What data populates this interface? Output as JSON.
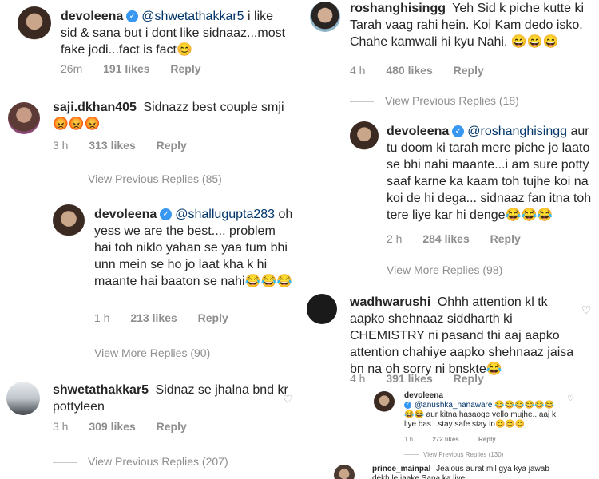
{
  "left": {
    "c1": {
      "user": "devoleena",
      "mention": "@shwetathakkar5",
      "text": "i like sid & sana but i dont like sidnaaz...most fake jodi...fact is fact😊",
      "time": "26m",
      "likes": "191 likes",
      "reply": "Reply"
    },
    "c2": {
      "user": "saji.dkhan405",
      "text": "Sidnazz best couple smji 😡😡😡",
      "time": "3 h",
      "likes": "313 likes",
      "reply": "Reply"
    },
    "vp1": "View Previous Replies (85)",
    "c3": {
      "user": "devoleena",
      "mention": "@shallugupta283",
      "text": "oh yess we are the best.... problem hai toh niklo yahan se yaa tum bhi unn mein se ho jo laat kha k hi maante hai baaton se nahi😂😂😂",
      "time": "1 h",
      "likes": "213 likes",
      "reply": "Reply"
    },
    "vm1": "View More Replies (90)",
    "c4": {
      "user": "shwetathakkar5",
      "text": "Sidnaz se jhalna bnd kr pottyleen",
      "time": "3 h",
      "likes": "309 likes",
      "reply": "Reply"
    },
    "vp2": "View Previous Replies (207)"
  },
  "right": {
    "c1": {
      "user": "roshanghisingg",
      "text": "Yeh Sid k piche kutte ki Tarah vaag rahi hein. Koi Kam dedo isko. Chahe kamwali hi kyu Nahi. 😄😄😄",
      "time": "4 h",
      "likes": "480 likes",
      "reply": "Reply"
    },
    "vp1": "View Previous Replies (18)",
    "c2": {
      "user": "devoleena",
      "mention": "@roshanghisingg",
      "text": "aur tu doom ki tarah mere piche jo laato se bhi nahi maante...i am sure potty saaf karne ka kaam toh tujhe koi na koi de hi dega... sidnaaz fan itna toh tere liye kar hi denge😂😂😂",
      "time": "2 h",
      "likes": "284 likes",
      "reply": "Reply"
    },
    "vm1": "View More Replies (98)",
    "c3": {
      "user": "wadhwarushi",
      "text": "Ohhh attention kl tk aapko shehnaaz siddharth ki CHEMISTRY ni pasand thi aaj aapko attention chahiye aapko shehnaaz jaisa bn na oh sorry ni bnskte😂",
      "time": "4 h",
      "likes": "391 likes",
      "reply": "Reply"
    },
    "c4": {
      "user": "devoleena",
      "mention": "@anushka_nanaware",
      "text": "😂😂😂😂😂😂😂😂 aur kitna hasaoge vello mujhe...aaj k liye bas...stay safe stay in😊😊😊",
      "time": "1 h",
      "likes": "272 likes",
      "reply": "Reply"
    },
    "vp2": "View Previous Replies (130)",
    "c5": {
      "user": "prince_mainpal",
      "text": "Jealous aurat mil gya kya jawab dekh le jaake Sana ka live"
    }
  },
  "icons": {
    "verified": "verified-badge-icon",
    "heart": "heart-icon"
  },
  "colors": {
    "verified": "#3897f0",
    "muted": "#8e8e8e",
    "mention": "#003569"
  }
}
